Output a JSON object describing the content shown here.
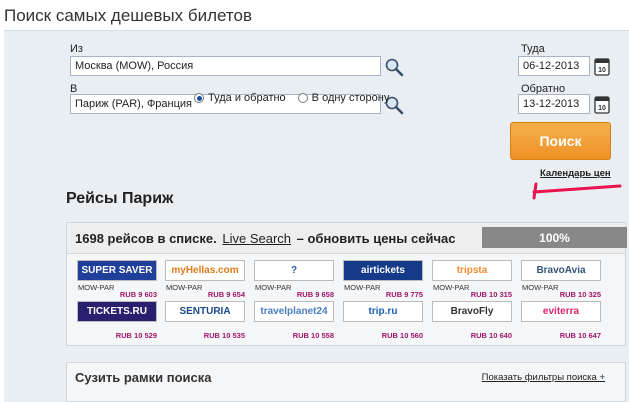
{
  "page_title": "Поиск самых дешевых билетов",
  "form": {
    "from_label": "Из",
    "from_value": "Москва (MOW), Россия",
    "to_label": "В",
    "to_value": "Париж (PAR), Франция",
    "depart_label": "Туда",
    "depart_value": "06-12-2013",
    "return_label": "Обратно",
    "return_value": "13-12-2013",
    "radio_roundtrip": "Туда и обратно",
    "radio_oneway": "В одну сторону",
    "roundtrip_selected": true,
    "search_button": "Поиск",
    "calendar_link": "Календарь цен"
  },
  "flights": {
    "title": "Рейсы Париж",
    "count_text": "1698 рейсов в списке.",
    "live_search": "Live Search",
    "refresh_text": "– обновить цены сейчас",
    "progress_text": "100%",
    "progress_value": 1.0
  },
  "agencies": [
    {
      "logo": "SUPER SAVER",
      "route": "MOW-PAR",
      "price": "RUB 9 603",
      "bg": "#1f3f9a",
      "fg": "#ffffff"
    },
    {
      "logo": "myHellas.com",
      "route": "MOW-PAR",
      "price": "RUB 9 654",
      "bg": "#ffffff",
      "fg": "#e07b1a"
    },
    {
      "logo": "?",
      "route": "MOW-PAR",
      "price": "RUB 9 658",
      "bg": "#ffffff",
      "fg": "#2a5aa8"
    },
    {
      "logo": "airtickets",
      "route": "MOW-PAR",
      "price": "RUB 9 775",
      "bg": "#163a8a",
      "fg": "#ffffff"
    },
    {
      "logo": "tripsta",
      "route": "MOW-PAR",
      "price": "RUB 10 315",
      "bg": "#ffffff",
      "fg": "#f28a2e"
    },
    {
      "logo": "BravoAvia",
      "route": "MOW-PAR",
      "price": "RUB 10 325",
      "bg": "#ffffff",
      "fg": "#335577"
    },
    {
      "logo": "TICKETS.RU",
      "route": "",
      "price": "RUB 10 529",
      "bg": "#2a1f6e",
      "fg": "#ffffff"
    },
    {
      "logo": "SENTURIA",
      "route": "",
      "price": "RUB 10 535",
      "bg": "#ffffff",
      "fg": "#1b4a8a"
    },
    {
      "logo": "travelplanet24",
      "route": "",
      "price": "RUB 10 558",
      "bg": "#ffffff",
      "fg": "#4a7fc0"
    },
    {
      "logo": "trip.ru",
      "route": "",
      "price": "RUB 10 560",
      "bg": "#ffffff",
      "fg": "#1b5fb8"
    },
    {
      "logo": "BravoFly",
      "route": "",
      "price": "RUB 10 640",
      "bg": "#ffffff",
      "fg": "#333333"
    },
    {
      "logo": "eviterra",
      "route": "",
      "price": "RUB 10 647",
      "bg": "#ffffff",
      "fg": "#e0246c"
    }
  ],
  "filters": {
    "title": "Сузить рамки поиска",
    "show_link": "Показать фильтры поиска +"
  },
  "colors": {
    "search_button": "#ee9125",
    "price": "#a0176b",
    "progress": "#888888",
    "annotation": "#e8134f"
  }
}
